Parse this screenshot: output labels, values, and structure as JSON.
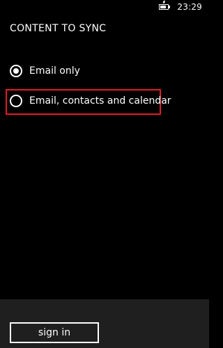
{
  "status_bar": {
    "time": "23:29",
    "battery_icon": "battery-charging-icon",
    "battery_level": 0.75
  },
  "header": {
    "title": "CONTENT TO SYNC"
  },
  "sync_options": [
    {
      "label": "Email only",
      "selected": true
    },
    {
      "label": "Email, contacts and calendar",
      "selected": false
    }
  ],
  "highlight": {
    "color": "#e51c23"
  },
  "footer": {
    "sign_in_label": "sign in"
  },
  "colors": {
    "background": "#000000",
    "foreground": "#ffffff",
    "app_bar": "#1f1f1f"
  }
}
